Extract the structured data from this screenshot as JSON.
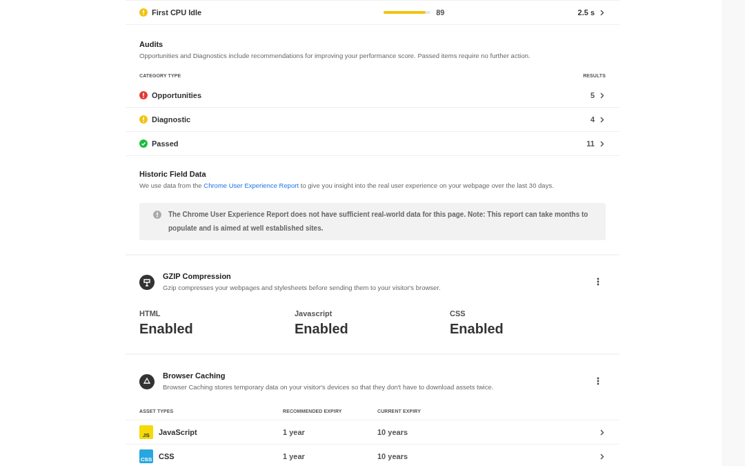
{
  "metric": {
    "label": "First CPU Idle",
    "kind": "warning",
    "level": 0.89,
    "score": "89",
    "value": "2.5 s"
  },
  "audits": {
    "title": "Audits",
    "description": "Opportunities and Diagnostics include recommendations for improving your performance score. Passed items require no further action.",
    "columns": [
      "CATEGORY TYPE",
      "RESULTS"
    ],
    "rows": [
      {
        "label": "Opportunities",
        "kind": "error",
        "count": "5"
      },
      {
        "label": "Diagnostic",
        "kind": "warning",
        "count": "4"
      },
      {
        "label": "Passed",
        "kind": "success",
        "count": "11"
      }
    ]
  },
  "field_data": {
    "title": "Historic Field Data",
    "description_before": "We use data from the ",
    "link": "Chrome User Experience Report",
    "description_after": " to give you insight into the real user experience on your webpage over the last 30 days.",
    "notice": "The Chrome User Experience Report does not have sufficient real-world data for this page. Note: This report can take months to populate and is aimed at well established sites."
  },
  "gzip": {
    "title": "GZIP Compression",
    "description": "Gzip compresses your webpages and stylesheets before sending them to your visitor's browser.",
    "items": [
      {
        "label": "HTML",
        "value": "Enabled"
      },
      {
        "label": "Javascript",
        "value": "Enabled"
      },
      {
        "label": "CSS",
        "value": "Enabled"
      }
    ]
  },
  "caching": {
    "title": "Browser Caching",
    "description": "Browser Caching stores temporary data on your visitor's devices so that they don't have to download assets twice.",
    "columns": [
      "ASSET TYPES",
      "RECOMMENDED EXPIRY",
      "CURRENT EXPIRY"
    ],
    "rows": [
      {
        "badge": "JS",
        "color": "#f5d90a",
        "name": "JavaScript",
        "recommended": "1 year",
        "current": "10 years"
      },
      {
        "badge": "CSS",
        "color": "#29a6e0",
        "name": "CSS",
        "recommended": "1 year",
        "current": "10 years"
      }
    ]
  }
}
